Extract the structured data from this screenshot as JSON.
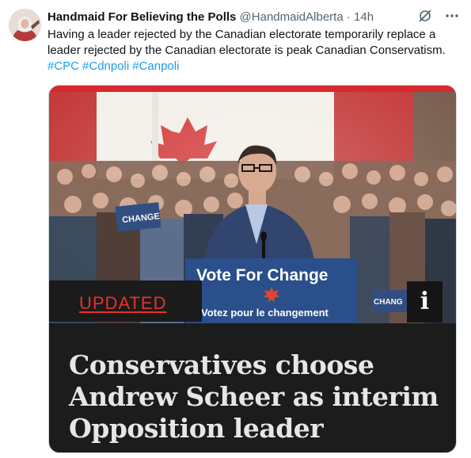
{
  "tweet": {
    "display_name": "Handmaid For Believing the Polls",
    "handle": "@HandmaidAlberta",
    "separator": "·",
    "time": "14h",
    "text": "Having a leader rejected by the Canadian electorate temporarily replace a leader rejected by the Canadian electorate is peak Canadian Conservatism.",
    "hashtags": [
      "#CPC",
      "#Cdnpoli",
      "#Canpoli"
    ],
    "actions": {
      "grok_icon": "grok-icon",
      "more_icon": "more-icon"
    }
  },
  "card": {
    "badge": "UPDATED",
    "info_glyph": "i",
    "headline": "Conservatives choose Andrew Scheer as interim Opposition leader",
    "podium_line1": "Vote For Change",
    "podium_line2": "Votez pour le changement",
    "crowd_sign": "CHANGE",
    "crowd_sign_right": "CHANG"
  },
  "colors": {
    "accent_blue": "#1d9bf0",
    "updated_red": "#e8302f",
    "card_bg": "#1c1c1c",
    "podium_blue": "#2a4f8a"
  }
}
